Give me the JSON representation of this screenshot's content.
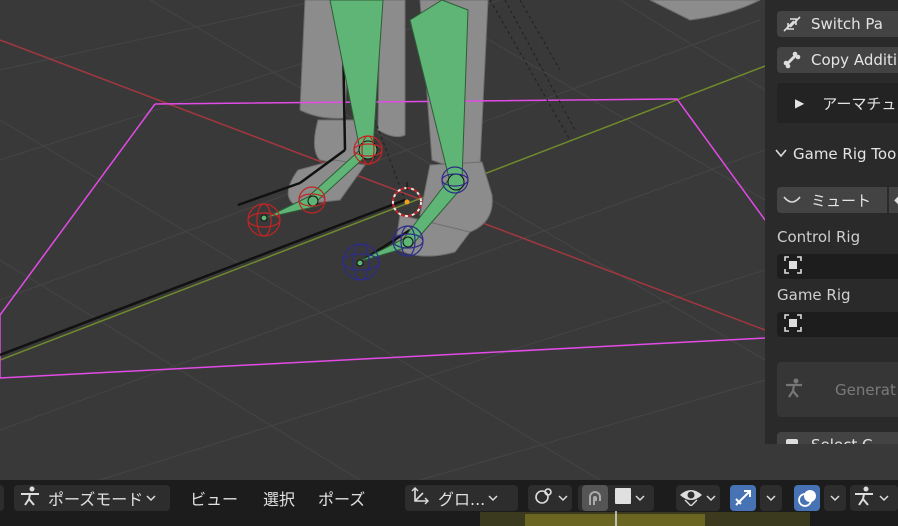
{
  "side_panel": {
    "switch_label": "Switch Pa",
    "copy_label": "Copy Additi",
    "armature_label": "アーマチュ",
    "section_title": "Game Rig Too",
    "mute_label": "ミュート",
    "control_rig_label": "Control Rig",
    "game_rig_label": "Game Rig",
    "generate_label": "Generat",
    "select_label": "Select C"
  },
  "header": {
    "mode_label": "ポーズモード",
    "menu_view": "ビュー",
    "menu_select": "選択",
    "menu_pose": "ポーズ",
    "orientation_label": "グロ..."
  },
  "colors": {
    "viewport_bg": "#393939",
    "bone_green": "#5fb575",
    "camera_frame": "#e24be6",
    "x_axis": "#a3373f",
    "y_axis": "#6f8a2c",
    "active_blue": "#4772b3"
  }
}
